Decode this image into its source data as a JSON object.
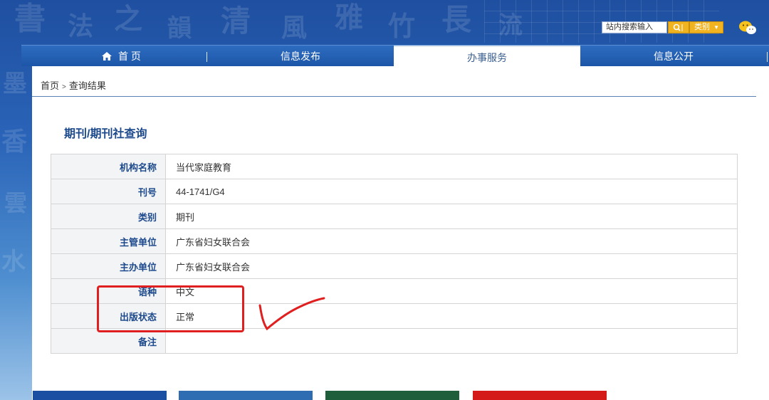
{
  "header": {
    "search_placeholder": "站内搜索输入",
    "category_label": "类别",
    "category_caret": "▼"
  },
  "nav": {
    "items": [
      {
        "label": "首 页"
      },
      {
        "label": "信息发布"
      },
      {
        "label": "办事服务"
      },
      {
        "label": "信息公开"
      }
    ],
    "active": "办事服务"
  },
  "breadcrumb": {
    "home": "首页",
    "separator": ">",
    "current": "查询结果"
  },
  "section_title": "期刊/期刊社查询",
  "record": [
    {
      "label": "机构名称",
      "value": "当代家庭教育"
    },
    {
      "label": "刊号",
      "value": "44-1741/G4"
    },
    {
      "label": "类别",
      "value": "期刊"
    },
    {
      "label": "主管单位",
      "value": "广东省妇女联合会"
    },
    {
      "label": "主办单位",
      "value": "广东省妇女联合会"
    },
    {
      "label": "语种",
      "value": "中文"
    },
    {
      "label": "出版状态",
      "value": "正常"
    },
    {
      "label": "备注",
      "value": ""
    }
  ],
  "colors": {
    "nav_blue": "#1d56a8",
    "title_blue": "#1d4a8c",
    "annotation_red": "#e02020",
    "accent_gold": "#f2b320"
  }
}
